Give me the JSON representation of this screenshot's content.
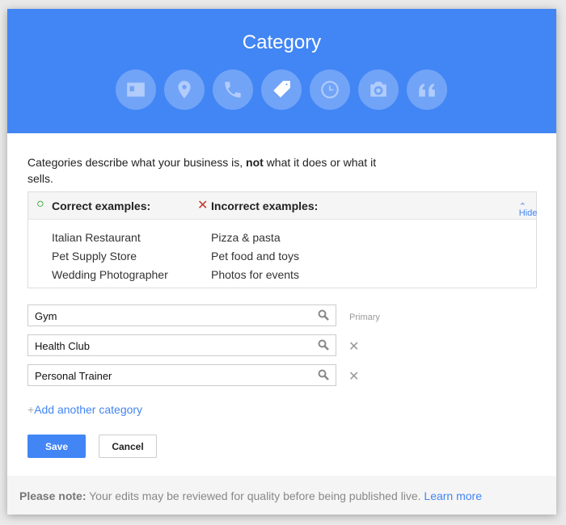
{
  "header": {
    "title": "Category",
    "icons": [
      "contact-card-icon",
      "location-pin-icon",
      "phone-icon",
      "tag-icon",
      "clock-icon",
      "camera-icon",
      "quote-icon"
    ],
    "active_icon": "tag-icon",
    "color": "#4285f4"
  },
  "description": {
    "before": "Categories describe what your business is, ",
    "bold": "not",
    "after": " what it does or what it sells."
  },
  "examples": {
    "correct_title": "Correct examples:",
    "incorrect_title": "Incorrect examples:",
    "hide_label": "Hide",
    "correct": [
      "Italian Restaurant",
      "Pet Supply Store",
      "Wedding Photographer"
    ],
    "incorrect": [
      "Pizza & pasta",
      "Pet food and toys",
      "Photos for events"
    ]
  },
  "categories": [
    {
      "value": "Gym",
      "label": "Primary"
    },
    {
      "value": "Health Club"
    },
    {
      "value": "Personal Trainer"
    }
  ],
  "add_label": "Add another category",
  "buttons": {
    "save": "Save",
    "cancel": "Cancel"
  },
  "note": {
    "bold": "Please note:",
    "text": " Your edits may be reviewed for quality before being published live. ",
    "link": "Learn more"
  }
}
